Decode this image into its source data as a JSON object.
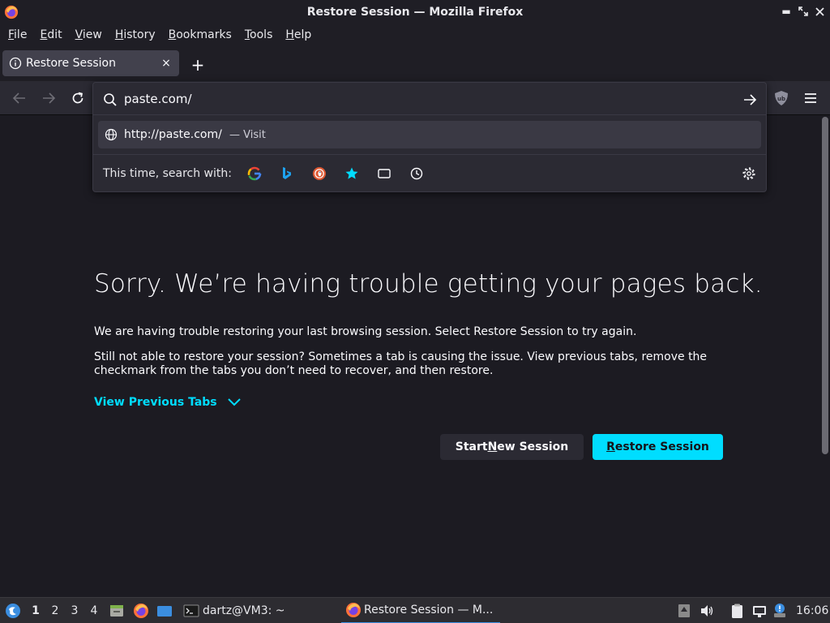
{
  "window": {
    "title": "Restore Session — Mozilla Firefox"
  },
  "menu": {
    "items": [
      {
        "underline": "F",
        "rest": "ile"
      },
      {
        "underline": "E",
        "rest": "dit"
      },
      {
        "underline": "V",
        "rest": "iew"
      },
      {
        "underline": "H",
        "rest": "istory"
      },
      {
        "underline": "B",
        "rest": "ookmarks"
      },
      {
        "underline": "T",
        "rest": "ools"
      },
      {
        "underline": "H",
        "rest": "elp"
      }
    ]
  },
  "tab": {
    "label": "Restore Session",
    "close": "×",
    "new_tab": "+"
  },
  "urlbar": {
    "value": "paste.com/"
  },
  "suggestion": {
    "url": "http://paste.com/",
    "action": "— Visit"
  },
  "search_with": {
    "label": "This time, search with:",
    "engines": [
      "google-icon",
      "bing-icon",
      "duckduckgo-icon",
      "bookmarks-star-icon",
      "tabs-icon",
      "history-icon"
    ]
  },
  "content": {
    "title": "Sorry. We’re having trouble getting your pages back.",
    "paragraph1": "We are having trouble restoring your last browsing session. Select Restore Session to try again.",
    "paragraph2": "Still not able to restore your session? Sometimes a tab is causing the issue. View previous tabs, remove the checkmark from the tabs you don’t need to recover, and then restore.",
    "view_previous": "View Previous Tabs",
    "start_new_pre": "Start ",
    "start_new_u": "N",
    "start_new_post": "ew Session",
    "restore_u": "R",
    "restore_post": "estore Session"
  },
  "taskbar": {
    "workspaces": [
      "1",
      "2",
      "3",
      "4"
    ],
    "terminal_label": "dartz@VM3: ~",
    "firefox_label": "Restore Session — M...",
    "clock": "16:06"
  },
  "colors": {
    "accent": "#00ddff",
    "background": "#1c1b22",
    "toolbar": "#2b2a33"
  }
}
